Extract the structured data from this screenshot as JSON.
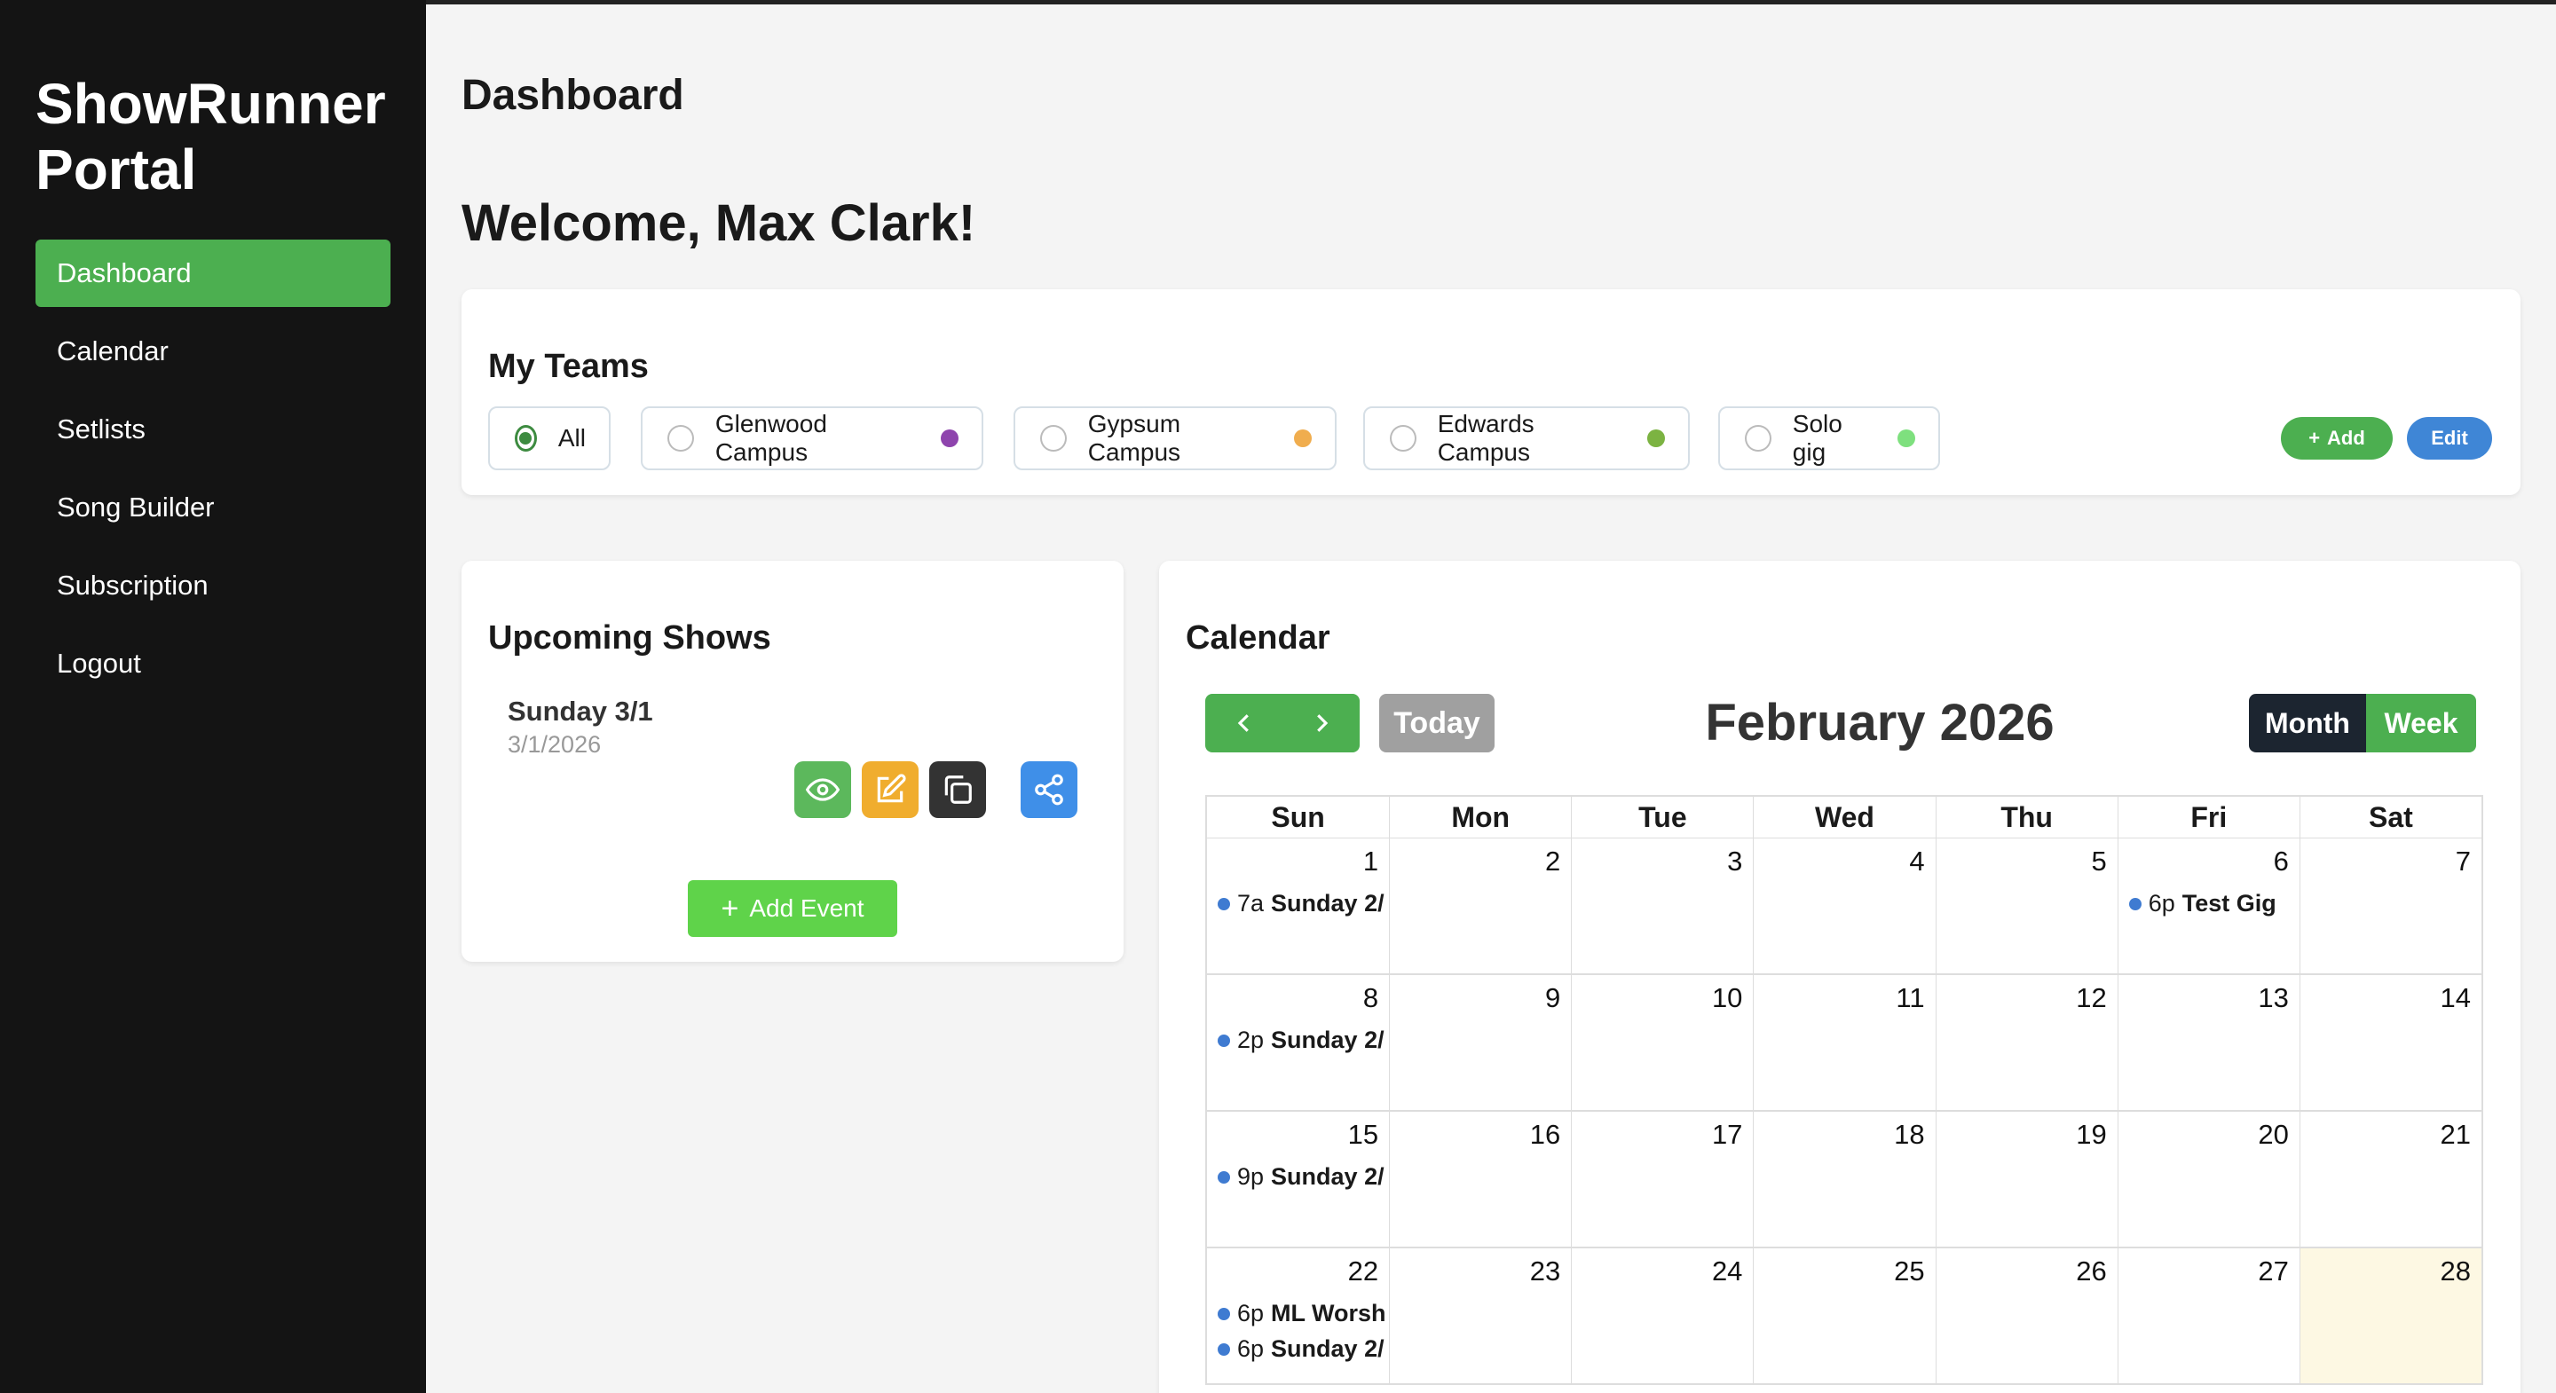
{
  "sidebar": {
    "brand": "ShowRunner Portal",
    "items": [
      {
        "label": "Dashboard"
      },
      {
        "label": "Calendar"
      },
      {
        "label": "Setlists"
      },
      {
        "label": "Song Builder"
      },
      {
        "label": "Subscription"
      },
      {
        "label": "Logout"
      }
    ]
  },
  "page": {
    "title": "Dashboard",
    "welcome": "Welcome, Max Clark!"
  },
  "teams": {
    "title": "My Teams",
    "items": [
      {
        "label": "All",
        "color": ""
      },
      {
        "label": "Glenwood Campus",
        "color": "#8e44ad"
      },
      {
        "label": "Gypsum Campus",
        "color": "#f0ad4e"
      },
      {
        "label": "Edwards Campus",
        "color": "#7cb342"
      },
      {
        "label": "Solo gig",
        "color": "#7ee07e"
      }
    ],
    "add_label": "Add",
    "edit_label": "Edit"
  },
  "upcoming": {
    "title": "Upcoming Shows",
    "shows": [
      {
        "title": "Sunday 3/1",
        "date": "3/1/2026"
      }
    ],
    "add_event_label": "Add Event"
  },
  "calendar": {
    "title": "Calendar",
    "today_label": "Today",
    "month_label": "February 2026",
    "view_month": "Month",
    "view_week": "Week",
    "weekdays": [
      "Sun",
      "Mon",
      "Tue",
      "Wed",
      "Thu",
      "Fri",
      "Sat"
    ],
    "weeks": [
      [
        {
          "day": "1",
          "events": [
            {
              "time": "7a",
              "title": "Sunday 2/"
            }
          ]
        },
        {
          "day": "2",
          "events": []
        },
        {
          "day": "3",
          "events": []
        },
        {
          "day": "4",
          "events": []
        },
        {
          "day": "5",
          "events": []
        },
        {
          "day": "6",
          "events": [
            {
              "time": "6p",
              "title": "Test Gig"
            }
          ]
        },
        {
          "day": "7",
          "events": []
        }
      ],
      [
        {
          "day": "8",
          "events": [
            {
              "time": "2p",
              "title": "Sunday 2/"
            }
          ]
        },
        {
          "day": "9",
          "events": []
        },
        {
          "day": "10",
          "events": []
        },
        {
          "day": "11",
          "events": []
        },
        {
          "day": "12",
          "events": []
        },
        {
          "day": "13",
          "events": []
        },
        {
          "day": "14",
          "events": []
        }
      ],
      [
        {
          "day": "15",
          "events": [
            {
              "time": "9p",
              "title": "Sunday 2/"
            }
          ]
        },
        {
          "day": "16",
          "events": []
        },
        {
          "day": "17",
          "events": []
        },
        {
          "day": "18",
          "events": []
        },
        {
          "day": "19",
          "events": []
        },
        {
          "day": "20",
          "events": []
        },
        {
          "day": "21",
          "events": []
        }
      ],
      [
        {
          "day": "22",
          "events": [
            {
              "time": "6p",
              "title": "ML Worsh"
            },
            {
              "time": "6p",
              "title": "Sunday 2/"
            }
          ]
        },
        {
          "day": "23",
          "events": []
        },
        {
          "day": "24",
          "events": []
        },
        {
          "day": "25",
          "events": []
        },
        {
          "day": "26",
          "events": []
        },
        {
          "day": "27",
          "events": []
        },
        {
          "day": "28",
          "events": [],
          "today": true
        }
      ]
    ]
  },
  "colors": {
    "accent_green": "#4caf50",
    "accent_blue": "#3f86d6",
    "sidebar_bg": "#141414",
    "event_dot": "#3f7bd1",
    "today_bg": "#fdf8e3"
  }
}
